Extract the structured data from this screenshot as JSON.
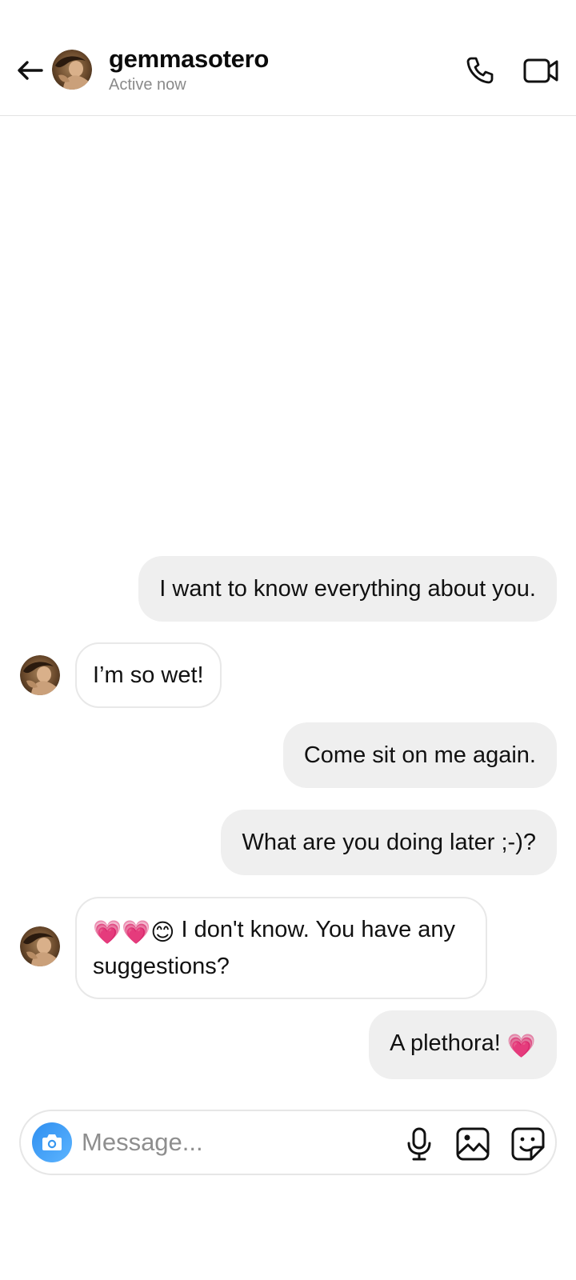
{
  "header": {
    "username": "gemmasotero",
    "status": "Active now",
    "back_icon": "arrow-left-icon",
    "call_icon": "phone-icon",
    "video_icon": "video-camera-icon"
  },
  "messages": [
    {
      "direction": "outgoing",
      "text": "I want to know everything about you."
    },
    {
      "direction": "incoming",
      "text": "I’m so wet!"
    },
    {
      "direction": "outgoing",
      "text": "Come sit on me again."
    },
    {
      "direction": "outgoing",
      "text": "What are you doing later ;-)?"
    },
    {
      "direction": "incoming",
      "emoji_prefix": "💗💗😊",
      "text": " I don't know. You have any",
      "text_line2": "suggestions?"
    },
    {
      "direction": "outgoing",
      "text": "A plethora! ",
      "emoji_suffix": "💗"
    }
  ],
  "composer": {
    "placeholder": "Message...",
    "camera_icon": "camera-icon",
    "mic_icon": "microphone-icon",
    "gallery_icon": "image-icon",
    "sticker_icon": "sticker-icon"
  },
  "colors": {
    "outgoing_bubble": "#efefef",
    "incoming_border": "#e8e8e8",
    "camera_button": "#3797f0",
    "status_text": "#8a8a8a"
  }
}
